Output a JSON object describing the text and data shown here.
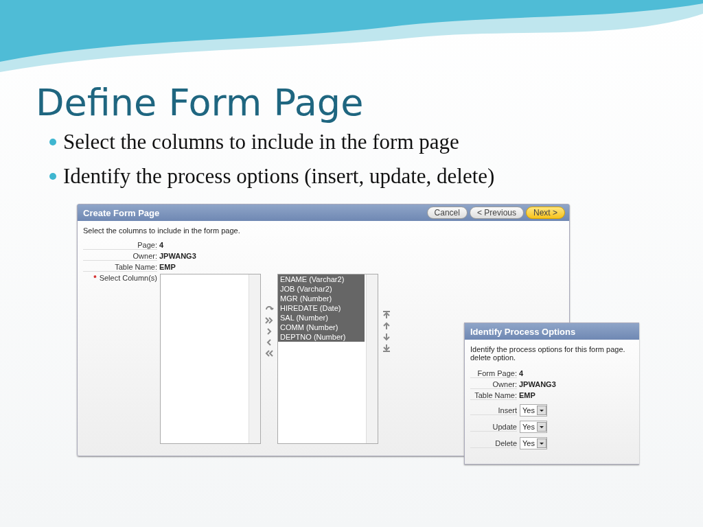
{
  "slide": {
    "title": "Define Form Page",
    "bullets": [
      "Select the columns to include in the form page",
      "Identify the process options (insert, update, delete)"
    ]
  },
  "create_form_page": {
    "title": "Create Form Page",
    "buttons": [
      {
        "label": "Cancel",
        "kind": "plain"
      },
      {
        "label": "< Previous",
        "kind": "plain"
      },
      {
        "label": "Next >",
        "kind": "primary"
      }
    ],
    "instruction": "Select the columns to include in the form page.",
    "fields": [
      {
        "label": "Page:",
        "value": "4"
      },
      {
        "label": "Owner:",
        "value": "JPWANG3"
      },
      {
        "label": "Table Name:",
        "value": "EMP"
      }
    ],
    "required_mark": "*",
    "select_label": "Select Column(s)",
    "selected_columns": [
      {
        "label": "ENAME (Varchar2)",
        "selected": true
      },
      {
        "label": "JOB (Varchar2)",
        "selected": true
      },
      {
        "label": "MGR (Number)",
        "selected": true
      },
      {
        "label": "HIREDATE (Date)",
        "selected": true
      },
      {
        "label": "SAL (Number)",
        "selected": true
      },
      {
        "label": "COMM (Number)",
        "selected": true
      },
      {
        "label": "DEPTNO (Number)",
        "selected": true
      }
    ]
  },
  "process_options": {
    "title": "Identify Process Options",
    "instruction": "Identify the process options for this form page.\ndelete option.",
    "fields": [
      {
        "label": "Form Page:",
        "value": "4"
      },
      {
        "label": "Owner:",
        "value": "JPWANG3"
      },
      {
        "label": "Table Name:",
        "value": "EMP"
      }
    ],
    "options": [
      {
        "label": "Insert",
        "value": "Yes"
      },
      {
        "label": "Update",
        "value": "Yes"
      },
      {
        "label": "Delete",
        "value": "Yes"
      }
    ]
  }
}
